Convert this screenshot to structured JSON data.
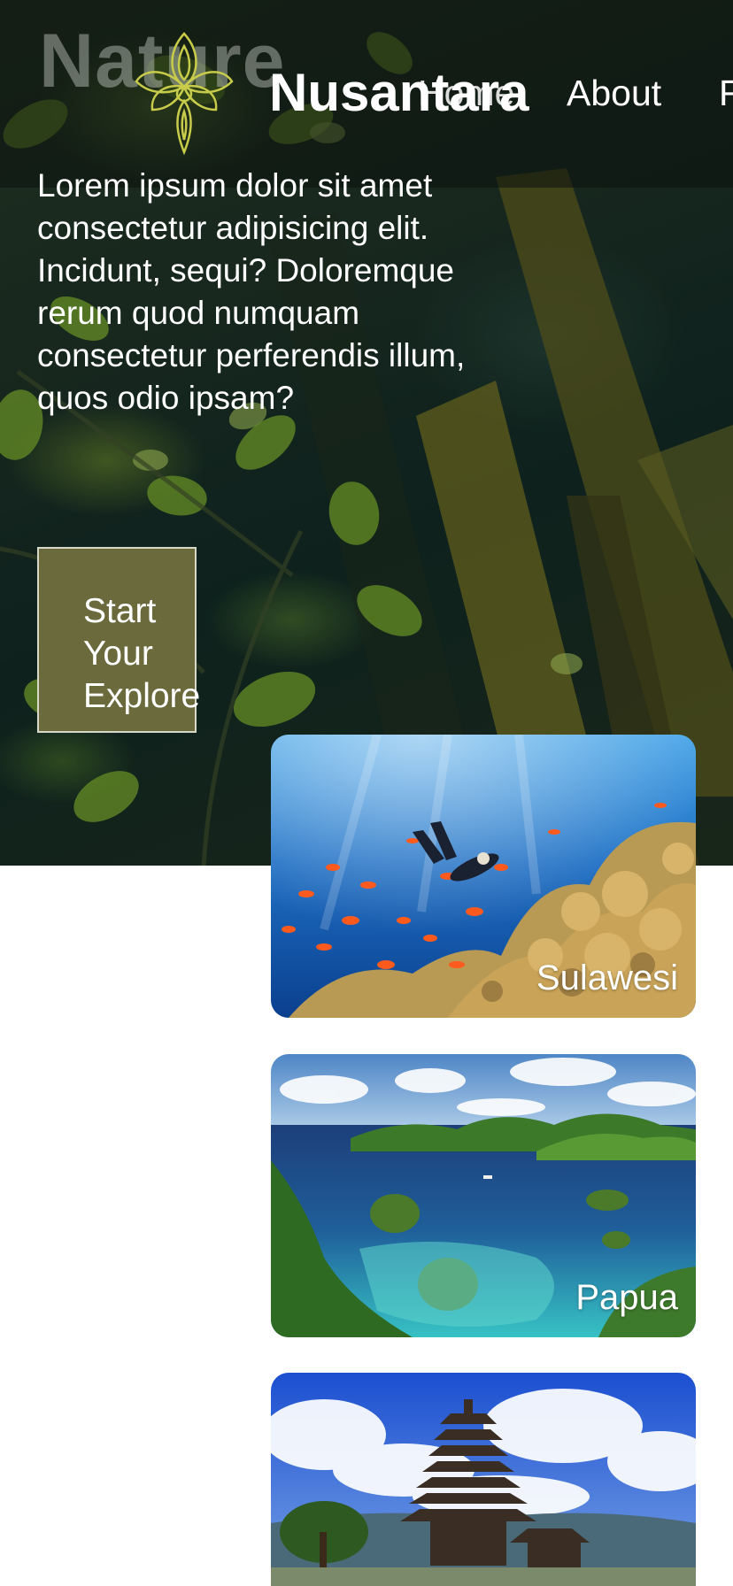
{
  "navbar": {
    "ghost_text": "Nature",
    "brand": "Nusantara",
    "links": [
      {
        "label": "Home"
      },
      {
        "label": "About"
      },
      {
        "label": "F"
      }
    ]
  },
  "hero": {
    "paragraph": "Lorem ipsum dolor sit amet consectetur adipisicing elit. Incidunt, sequi? Doloremque rerum quod numquam consectetur perferendis illum, quos odio ipsam?",
    "cta_lines": [
      "Start",
      "Your",
      "Explore"
    ]
  },
  "destinations": [
    {
      "name": "Sulawesi"
    },
    {
      "name": "Papua"
    },
    {
      "name": ""
    }
  ],
  "colors": {
    "cta_background": "#6b6a3c",
    "logo_gold": "#c8cc4a"
  }
}
